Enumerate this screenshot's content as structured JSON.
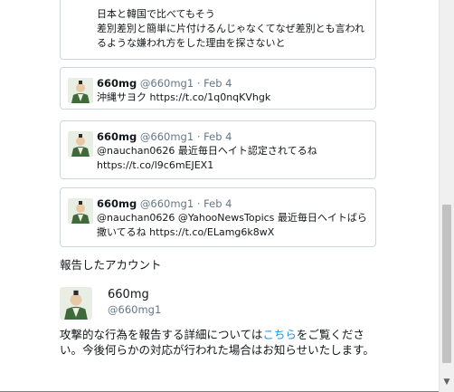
{
  "first_tweet": {
    "lines": [
      "日本と韓国で比べてもそう",
      "差別差別と簡単に片付けるんじゃなくてなぜ差別とも言われ",
      "るような嫌われ方をした理由を探さないと"
    ]
  },
  "tweets": [
    {
      "name": "660mg",
      "handle": "@660mg1",
      "separator": "·",
      "date": "Feb 4",
      "text": "沖縄サヨク https://t.co/1q0nqKVhgk"
    },
    {
      "name": "660mg",
      "handle": "@660mg1",
      "separator": "·",
      "date": "Feb 4",
      "text": "@nauchan0626 最近毎日ヘイト認定されてるね https://t.co/l9c6mEJEX1"
    },
    {
      "name": "660mg",
      "handle": "@660mg1",
      "separator": "·",
      "date": "Feb 4",
      "text": "@nauchan0626 @YahooNewsTopics 最近毎日ヘイトばら撒いてるね https://t.co/ELamg6k8wX"
    }
  ],
  "reported_account": {
    "section_title": "報告したアカウント",
    "name": "660mg",
    "handle": "@660mg1"
  },
  "info": {
    "before_link": "攻撃的な行為を報告する詳細については",
    "link_text": "こちら",
    "after_link": "をご覧ください。今後何らかの対応が行われた場合はお知らせいたします。"
  },
  "scrollbar": {
    "up_icon": "triangle-up-icon",
    "down_icon": "triangle-down-icon"
  },
  "colors": {
    "link": "#1b95e0",
    "muted": "#657786",
    "border": "#ccd6dd"
  }
}
